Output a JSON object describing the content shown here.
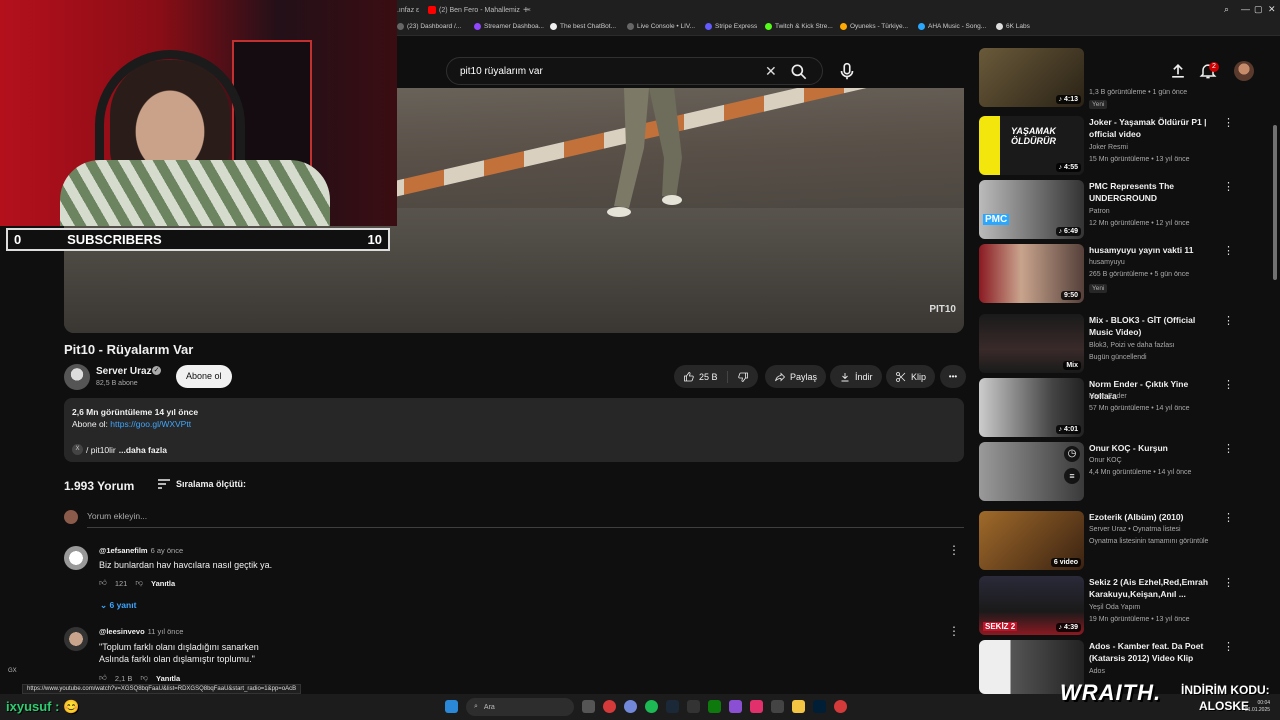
{
  "browser": {
    "tabs": [
      {
        "label": "..ınfaz ε"
      },
      {
        "label": "(2) Ben Fero - Mahallemiz",
        "active": true
      }
    ],
    "new_tab": "+",
    "bookmarks": [
      "(23) Dashboard /...",
      "Streamer Dashboa...",
      "The best ChatBot...",
      "Live Console • LIV...",
      "Stripe Express",
      "Twitch & Kick Stre...",
      "Oyuneks - Türkiye...",
      "AHA Music - Song...",
      "6K Labs"
    ]
  },
  "header": {
    "search_value": "pit10 rüyalarım var",
    "notification_count": "2"
  },
  "overlay": {
    "subscribers_label": "SUBSCRIBERS",
    "subscribers_current": "0",
    "subscribers_goal": "10",
    "chat_user": "ixyusuf :",
    "chat_emoji": "😊",
    "brand": "WRAITH.",
    "promo_line1": "İNDİRİM KODU:",
    "promo_line2": "ALOSKE"
  },
  "video": {
    "title": "Pit10 - Rüyalarım Var",
    "watermark": "PIT10",
    "channel_name": "Server Uraz",
    "channel_subs": "82,5 B abone",
    "subscribe_label": "Abone ol",
    "like_count": "25 B",
    "share_label": "Paylaş",
    "download_label": "İndir",
    "clip_label": "Klip",
    "more_label": "•••"
  },
  "description": {
    "stats": "2,6 Mn görüntüleme  14 yıl önce",
    "subscribe_prefix": "Abone ol: ",
    "subscribe_link": "https://goo.gl/WXVPtt",
    "hashtag_text": "/ pit10lir",
    "more_label": "...daha fazla"
  },
  "comments": {
    "count": "1.993 Yorum",
    "sort_label": "Sıralama ölçütü:",
    "add_placeholder": "Yorum ekleyin...",
    "items": [
      {
        "user": "@1efsanefilm",
        "time": "6 ay önce",
        "text": "Biz bunlardan hav havcılara nasıl geçtik ya.",
        "likes": "121",
        "reply": "Yanıtla",
        "replies": "6 yanıt"
      },
      {
        "user": "@leesinvevo",
        "time": "11 yıl önce",
        "text1": "\"Toplum farklı olanı dışladığını sanarken",
        "text2": "Aslında farklı olan dışlamıştır toplumu.\"",
        "likes": "2,1 B",
        "reply": "Yanıtla"
      }
    ]
  },
  "sidebar": {
    "items": [
      {
        "title": "",
        "channel": "",
        "meta": "1,3 B görüntüleme • 1 gün önce",
        "badge": "Yeni",
        "duration": "♪ 4:13"
      },
      {
        "title": "Joker - Yaşamak Öldürür P1 | official video",
        "channel": "Joker Resmi",
        "meta": "15 Mn görüntüleme • 13 yıl önce",
        "duration": "♪ 4:55",
        "thumb_text": "YAŞAMAK ÖLDÜRÜR"
      },
      {
        "title": "PMC Represents The UNDERGROUND",
        "channel": "Patron",
        "meta": "12 Mn görüntüleme • 12 yıl önce",
        "duration": "♪ 6:49",
        "thumb_text": "PMC"
      },
      {
        "title": "husamyuyu yayın vakti 11",
        "channel": "husamyuyu",
        "meta": "265 B görüntüleme • 5 gün önce",
        "badge": "Yeni",
        "duration": "9:50"
      },
      {
        "title": "Mix - BLOK3 - GİT (Official Music Video)",
        "channel": "Blok3, Poizi ve daha fazlası",
        "meta": "Bugün güncellendi",
        "duration": "Mix"
      },
      {
        "title": "Norm Ender - Çıktık Yine Yollara",
        "channel": "Norm Ender",
        "meta": "57 Mn görüntüleme • 14 yıl önce",
        "duration": "♪ 4:01"
      },
      {
        "title": "Onur KOÇ - Kurşun",
        "channel": "Onur KOÇ",
        "meta": "4,4 Mn görüntüleme • 14 yıl önce",
        "duration": ""
      },
      {
        "title": "Ezoterik (Albüm) (2010)",
        "channel": "Server Uraz • Oynatma listesi",
        "meta": "Oynatma listesinin tamamını görüntüle",
        "duration": "6 video"
      },
      {
        "title": "Sekiz 2 (Ais Ezhel,Red,Emrah Karakuyu,Keişan,Anıl ...",
        "channel": "Yeşil Oda Yapım",
        "meta": "19 Mn görüntüleme • 13 yıl önce",
        "duration": "♪ 4:39",
        "thumb_text": "SEKİZ 2"
      },
      {
        "title": "Ados - Kamber feat. Da Poet (Katarsis 2012) Video Klip",
        "channel": "Ados",
        "meta": "",
        "duration": ""
      }
    ]
  },
  "status_url": "https://www.youtube.com/watch?v=XGSQ8bqFaaU&list=RDXGSQ8bqFaaU&start_radio=1&pp=oAcB",
  "taskbar": {
    "search_placeholder": "Ara",
    "time": "00:04",
    "date": "31.01.2025",
    "gx_label": "GX"
  },
  "colors": {
    "background": "#0f0f0f",
    "accent_link": "#3ea6ff",
    "chat_name": "#2ecc71",
    "youtube_red": "#cc0000"
  }
}
